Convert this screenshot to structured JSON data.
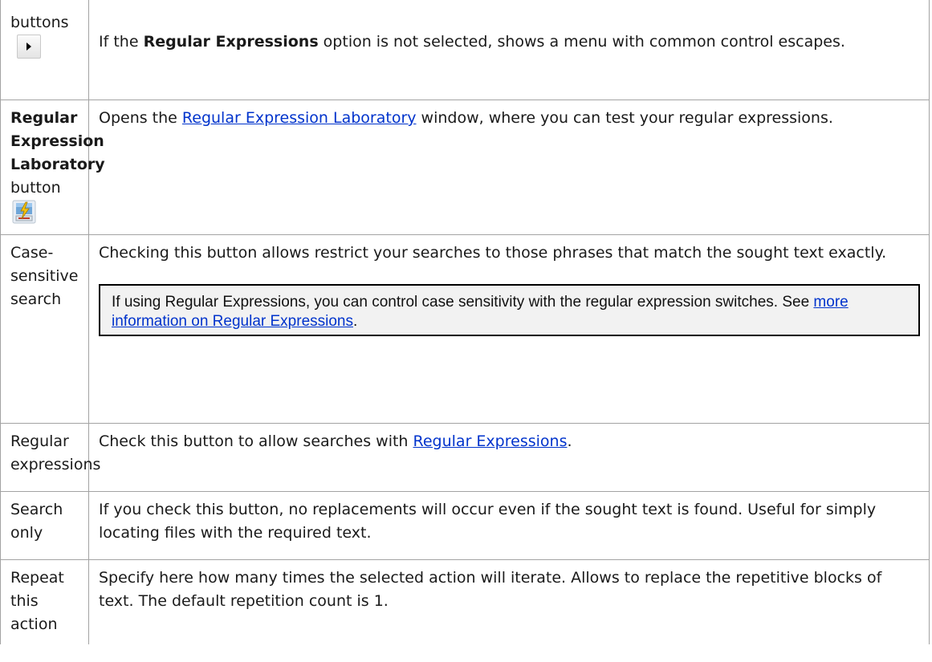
{
  "rows": [
    {
      "term_text": "buttons",
      "term_icon": "play-arrow-icon",
      "desc_prefix": "If the ",
      "desc_bold": "Regular Expressions",
      "desc_suffix": " option is not selected, shows a menu with common control escapes."
    },
    {
      "term_bold": "Regular Expression Laboratory",
      "term_text": "button",
      "term_icon": "regex-lab-icon",
      "desc_prefix": "Opens the ",
      "desc_link": "Regular Expression Laboratory",
      "desc_suffix": " window, where you can test your regular expressions."
    },
    {
      "term_text": "Case-sensitive search",
      "desc_text": "Checking this button allows restrict your searches to those phrases that match the sought text exactly.",
      "note_prefix": "If using Regular Expressions, you can control case sensitivity with the regular expression switches. See ",
      "note_link": "more information on Regular Expressions",
      "note_suffix": "."
    },
    {
      "term_text": "Regular expressions",
      "desc_prefix": "Check this button to allow searches with ",
      "desc_link": "Regular Expressions",
      "desc_suffix": "."
    },
    {
      "term_text": "Search only",
      "desc_text": "If you check this button, no replacements will occur even if the sought text is found. Useful for simply locating files with the required text."
    },
    {
      "term_text": "Repeat this action",
      "desc_text": "Specify here how many times the selected action will iterate. Allows to replace the repetitive blocks of text. The default repetition count is 1."
    }
  ],
  "colors": {
    "link": "#0033cc",
    "border": "#a3a3a3",
    "note_background": "#f2f2f2"
  }
}
